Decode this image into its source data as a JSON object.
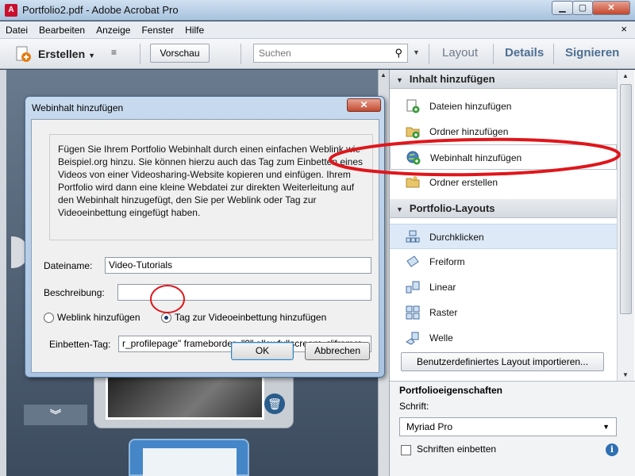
{
  "window": {
    "title": "Portfolio2.pdf - Adobe Acrobat Pro",
    "min_symbol": "▁",
    "max_symbol": "▢",
    "close_symbol": "✕"
  },
  "menu": {
    "items": [
      "Datei",
      "Bearbeiten",
      "Anzeige",
      "Fenster",
      "Hilfe"
    ],
    "close_symbol": "×"
  },
  "toolbar": {
    "create_label": "Erstellen",
    "preview_label": "Vorschau",
    "search_placeholder": "Suchen",
    "tab_layout": "Layout",
    "tab_details": "Details",
    "tab_sign": "Signieren"
  },
  "dialog": {
    "title": "Webinhalt hinzufügen",
    "close_symbol": "✕",
    "description": "Fügen Sie Ihrem Portfolio Webinhalt durch einen einfachen Weblink wie Beispiel.org hinzu. Sie können hierzu auch das Tag zum Einbetten eines Videos von einer Videosharing-Website kopieren und einfügen. Ihrem Portfolio wird dann eine kleine Webdatei zur direkten Weiterleitung auf den Webinhalt hinzugefügt, den Sie per Weblink oder Tag zur Videoeinbettung eingefügt haben.",
    "filename_label": "Dateiname:",
    "filename_value": "Video-Tutorials",
    "description_label": "Beschreibung:",
    "description_value": "",
    "radio_weblink": "Weblink hinzufügen",
    "radio_tag": "Tag zur Videoeinbettung hinzufügen",
    "selected_radio": "tag",
    "embed_label": "Einbetten-Tag:",
    "embed_value": "r_profilepage\" frameborder=\"0\" allowfullscreen></iframe>",
    "ok_label": "OK",
    "cancel_label": "Abbrechen"
  },
  "panel": {
    "section_add": "Inhalt hinzufügen",
    "add_items": [
      {
        "label": "Dateien hinzufügen",
        "icon": "add-files-icon"
      },
      {
        "label": "Ordner hinzufügen",
        "icon": "add-folder-icon"
      },
      {
        "label": "Webinhalt hinzufügen",
        "icon": "add-web-content-icon"
      },
      {
        "label": "Ordner erstellen",
        "icon": "create-folder-icon"
      }
    ],
    "section_layouts": "Portfolio-Layouts",
    "layout_items": [
      {
        "label": "Durchklicken",
        "icon": "click-through-icon"
      },
      {
        "label": "Freiform",
        "icon": "freeform-icon"
      },
      {
        "label": "Linear",
        "icon": "linear-icon"
      },
      {
        "label": "Raster",
        "icon": "grid-icon"
      },
      {
        "label": "Welle",
        "icon": "wave-icon"
      }
    ],
    "import_label": "Benutzerdefiniertes Layout importieren...",
    "props_title": "Portfolioeigenschaften",
    "font_label": "Schrift:",
    "font_value": "Myriad Pro",
    "embed_fonts_label": "Schriften einbetten",
    "embed_fonts_checked": false
  },
  "colors": {
    "annotation_red": "#e0161b",
    "tab_blue": "#4d6f92"
  }
}
